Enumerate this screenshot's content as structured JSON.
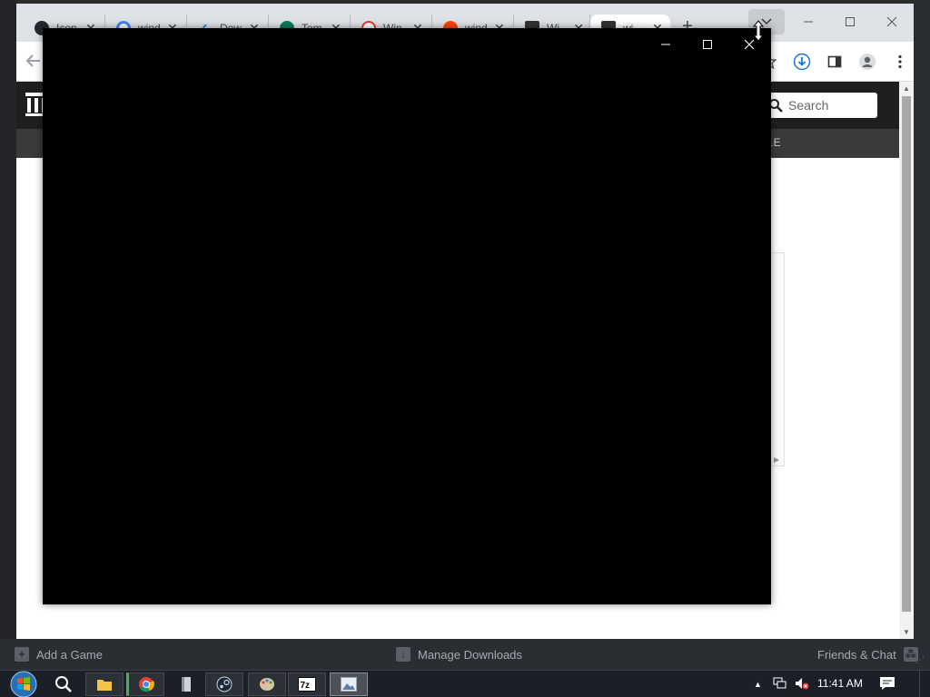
{
  "browser": {
    "tabs": [
      {
        "label": "Icon",
        "color": "#24292f"
      },
      {
        "label": "wind",
        "color": "#4285f4"
      },
      {
        "label": "Dow",
        "color": "#1a73e8"
      },
      {
        "label": "Tem",
        "color": "#0b7a5c"
      },
      {
        "label": "Win",
        "color": "#e53935"
      },
      {
        "label": "wind",
        "color": "#ff4500"
      },
      {
        "label": "Wi",
        "color": "#333333"
      },
      {
        "label": "wi",
        "color": "#333333"
      }
    ],
    "new_tab": "+"
  },
  "site": {
    "search_placeholder": "Search",
    "nav_fragment": "LE"
  },
  "steam": {
    "add_game": "Add a Game",
    "manage_downloads": "Manage Downloads",
    "friends_chat": "Friends & Chat"
  },
  "taskbar": {
    "clock": "11:41 AM"
  },
  "colors": {
    "accent": "#1a73e8",
    "popup_bg": "#000000"
  }
}
